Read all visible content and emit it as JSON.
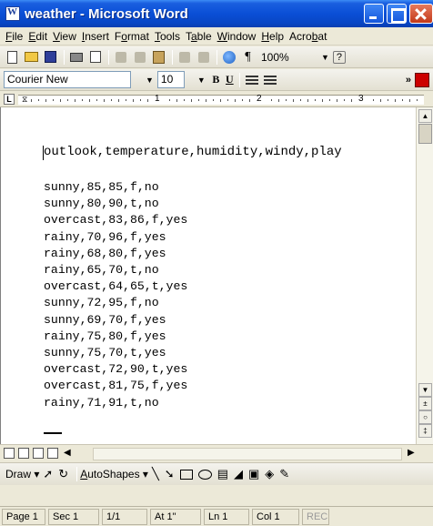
{
  "window": {
    "title": "weather - Microsoft Word"
  },
  "menu": [
    {
      "pre": "",
      "key": "F",
      "post": "ile"
    },
    {
      "pre": "",
      "key": "E",
      "post": "dit"
    },
    {
      "pre": "",
      "key": "V",
      "post": "iew"
    },
    {
      "pre": "",
      "key": "I",
      "post": "nsert"
    },
    {
      "pre": "F",
      "key": "o",
      "post": "rmat"
    },
    {
      "pre": "",
      "key": "T",
      "post": "ools"
    },
    {
      "pre": "T",
      "key": "a",
      "post": "ble"
    },
    {
      "pre": "",
      "key": "W",
      "post": "indow"
    },
    {
      "pre": "",
      "key": "H",
      "post": "elp"
    },
    {
      "pre": "Acro",
      "key": "b",
      "post": "at"
    }
  ],
  "toolbar": {
    "zoom": "100%"
  },
  "format": {
    "font_name": "Courier New",
    "font_size": "10",
    "bold": "B",
    "underline": "U"
  },
  "ruler": {
    "marks": [
      "1",
      "2",
      "3"
    ]
  },
  "document": {
    "header": "outlook,temperature,humidity,windy,play",
    "rows": [
      "sunny,85,85,f,no",
      "sunny,80,90,t,no",
      "overcast,83,86,f,yes",
      "rainy,70,96,f,yes",
      "rainy,68,80,f,yes",
      "rainy,65,70,t,no",
      "overcast,64,65,t,yes",
      "sunny,72,95,f,no",
      "sunny,69,70,f,yes",
      "rainy,75,80,f,yes",
      "sunny,75,70,t,yes",
      "overcast,72,90,t,yes",
      "overcast,81,75,f,yes",
      "rainy,71,91,t,no"
    ]
  },
  "drawing": {
    "draw": "Draw",
    "autoshapes_pre": "",
    "autoshapes_key": "A",
    "autoshapes_post": "utoShapes"
  },
  "status": {
    "page": "Page 1",
    "sec": "Sec 1",
    "pages": "1/1",
    "at": "At 1\"",
    "ln": "Ln 1",
    "col": "Col 1",
    "rec": "REC"
  }
}
